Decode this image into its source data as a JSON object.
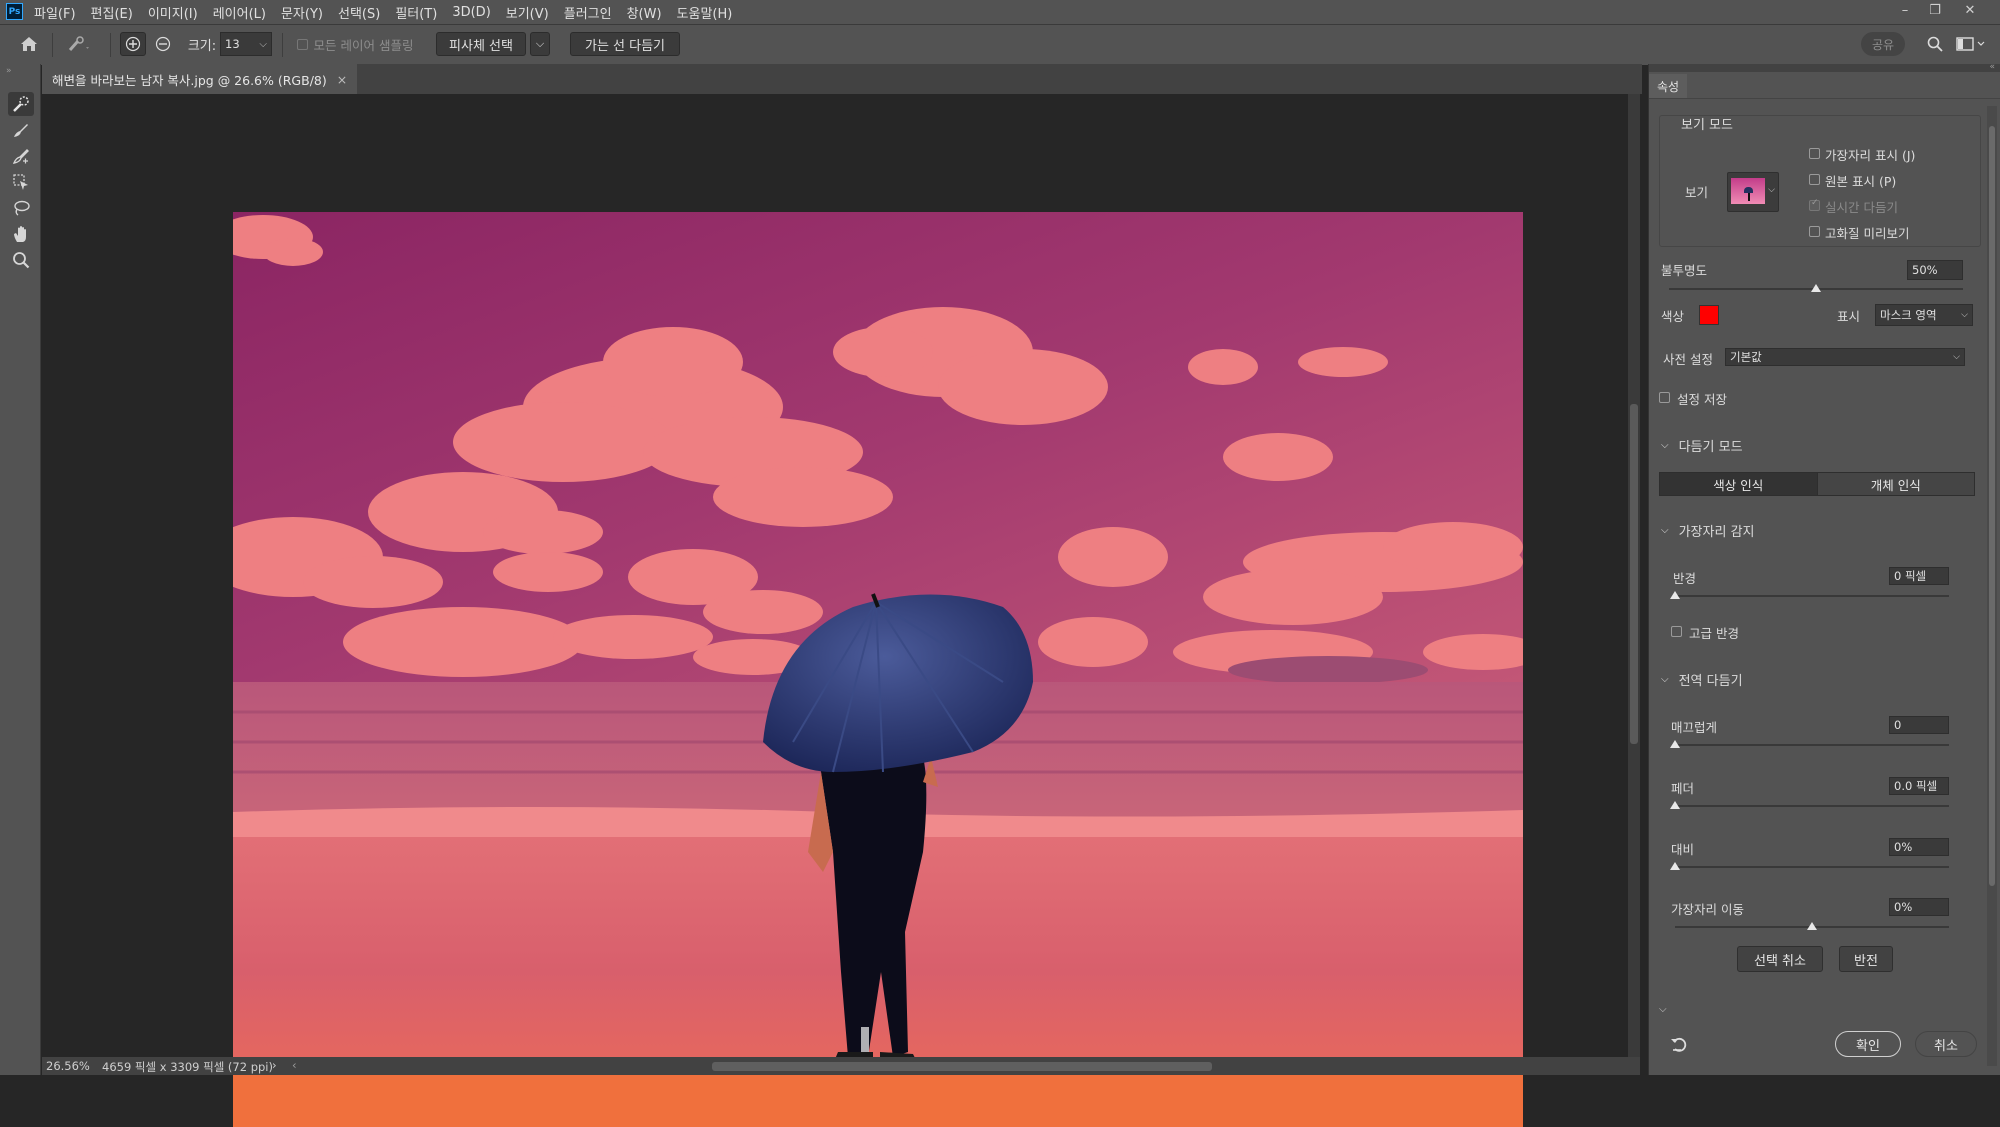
{
  "app": {
    "logo": "Ps"
  },
  "menu": [
    "파일(F)",
    "편집(E)",
    "이미지(I)",
    "레이어(L)",
    "문자(Y)",
    "선택(S)",
    "필터(T)",
    "3D(D)",
    "보기(V)",
    "플러그인",
    "창(W)",
    "도움말(H)"
  ],
  "options": {
    "size_label": "크기:",
    "size_value": "13",
    "sample_all_layers": "모든 레이어 샘플링",
    "select_subject": "피사체 선택",
    "refine_hair": "가는 선 다듬기",
    "share": "공유"
  },
  "document": {
    "tab_title": "해변을 바라보는 남자 복사.jpg @ 26.6% (RGB/8)",
    "close": "×"
  },
  "status": {
    "zoom": "26.56%",
    "info": "4659 픽셀 x 3309 픽셀 (72 ppi)",
    "arrow": "›",
    "arrow_left": "‹"
  },
  "panel": {
    "tab": "속성",
    "view_mode": {
      "title": "보기 모드",
      "view_label": "보기",
      "options": [
        "가장자리 표시 (J)",
        "원본 표시 (P)",
        "실시간 다듬기",
        "고화질 미리보기"
      ],
      "checked": [
        false,
        false,
        true,
        false
      ]
    },
    "opacity_label": "불투명도",
    "opacity_value": "50%",
    "opacity_level": 0.5,
    "color_label": "색상",
    "overlay_color": "#ff0000",
    "display_label": "표시",
    "display_value": "마스크 영역",
    "preset_label": "사전 설정",
    "preset_value": "기본값",
    "save_settings": "설정 저장",
    "refine_mode": {
      "title": "다듬기 모드",
      "color_aware": "색상 인식",
      "object_aware": "개체 인식"
    },
    "edge_detection": {
      "title": "가장자리 감지",
      "radius_label": "반경",
      "radius_value": "0 픽셀",
      "smart_radius": "고급 반경"
    },
    "global_refine": {
      "title": "전역 다듬기",
      "smooth_label": "매끄럽게",
      "smooth_value": "0",
      "feather_label": "페더",
      "feather_value": "0.0 픽셀",
      "contrast_label": "대비",
      "contrast_value": "0%",
      "shift_edge_label": "가장자리 이동",
      "shift_edge_value": "0%"
    },
    "deselect": "선택 취소",
    "invert": "반전",
    "ok": "확인",
    "cancel": "취소"
  }
}
